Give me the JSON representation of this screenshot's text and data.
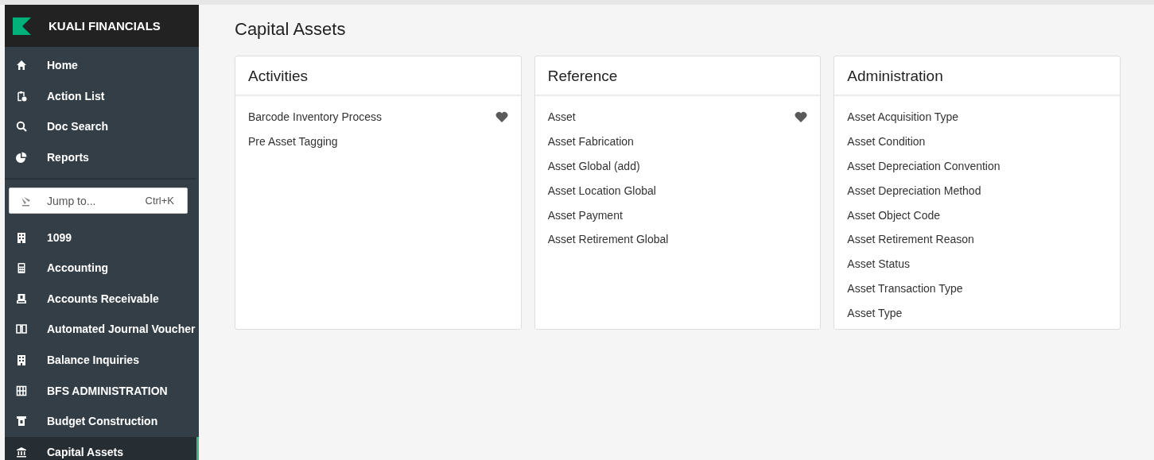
{
  "brand": {
    "title": "KUALI FINANCIALS"
  },
  "sidebar": {
    "top_items": [
      {
        "label": "Home",
        "selected": false
      },
      {
        "label": "Action List",
        "selected": false
      },
      {
        "label": "Doc Search",
        "selected": false
      },
      {
        "label": "Reports",
        "selected": false
      }
    ],
    "jump": {
      "placeholder": "Jump to...",
      "shortcut": "Ctrl+K"
    },
    "modules": [
      {
        "label": "1099",
        "selected": false
      },
      {
        "label": "Accounting",
        "selected": false
      },
      {
        "label": "Accounts Receivable",
        "selected": false
      },
      {
        "label": "Automated Journal Voucher",
        "selected": false
      },
      {
        "label": "Balance Inquiries",
        "selected": false
      },
      {
        "label": "BFS ADMINISTRATION",
        "selected": false
      },
      {
        "label": "Budget Construction",
        "selected": false
      },
      {
        "label": "Capital Assets",
        "selected": true
      }
    ]
  },
  "page": {
    "title": "Capital Assets",
    "cards": [
      {
        "title": "Activities",
        "links": [
          {
            "label": "Barcode Inventory Process",
            "favorite": true
          },
          {
            "label": "Pre Asset Tagging",
            "favorite": false
          }
        ]
      },
      {
        "title": "Reference",
        "links": [
          {
            "label": "Asset",
            "favorite": true
          },
          {
            "label": "Asset Fabrication",
            "favorite": false
          },
          {
            "label": "Asset Global (add)",
            "favorite": false
          },
          {
            "label": "Asset Location Global",
            "favorite": false
          },
          {
            "label": "Asset Payment",
            "favorite": false
          },
          {
            "label": "Asset Retirement Global",
            "favorite": false
          }
        ]
      },
      {
        "title": "Administration",
        "links": [
          {
            "label": "Asset Acquisition Type",
            "favorite": false
          },
          {
            "label": "Asset Condition",
            "favorite": false
          },
          {
            "label": "Asset Depreciation Convention",
            "favorite": false
          },
          {
            "label": "Asset Depreciation Method",
            "favorite": false
          },
          {
            "label": "Asset Object Code",
            "favorite": false
          },
          {
            "label": "Asset Retirement Reason",
            "favorite": false
          },
          {
            "label": "Asset Status",
            "favorite": false
          },
          {
            "label": "Asset Transaction Type",
            "favorite": false
          },
          {
            "label": "Asset Type",
            "favorite": false
          }
        ]
      }
    ]
  }
}
